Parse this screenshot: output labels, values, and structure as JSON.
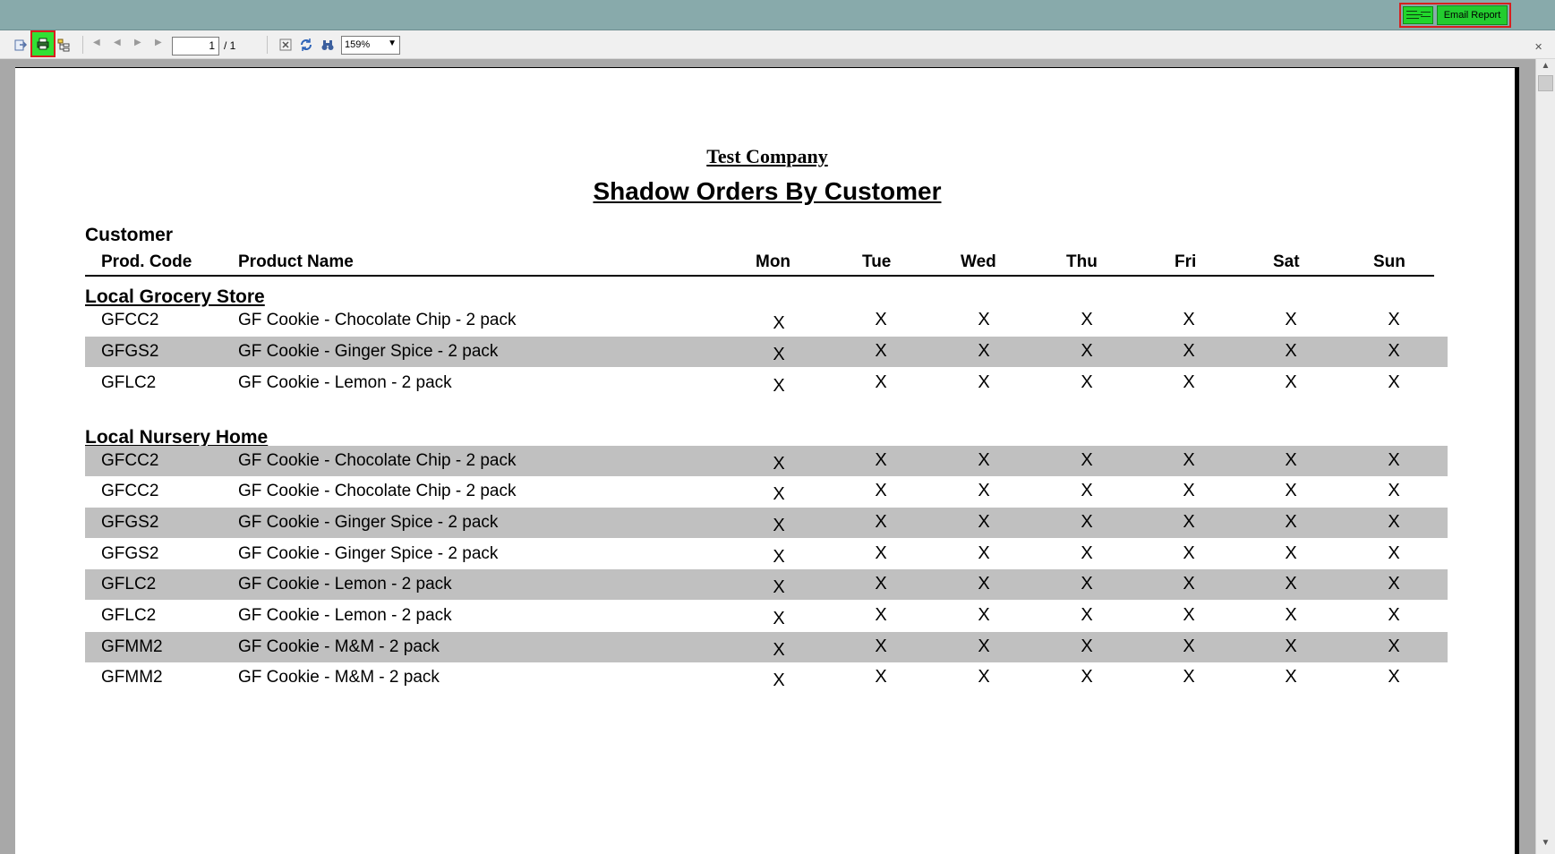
{
  "toolbar": {
    "email_label": "Email Report",
    "page_current": "1",
    "page_total": "/ 1",
    "zoom": "159%"
  },
  "report": {
    "company": "Test Company",
    "title": "Shadow Orders By Customer",
    "customer_header": "Customer",
    "columns": {
      "code": "Prod. Code",
      "name": "Product Name",
      "mon": "Mon",
      "tue": "Tue",
      "wed": "Wed",
      "thu": "Thu",
      "fri": "Fri",
      "sat": "Sat",
      "sun": "Sun"
    },
    "groups": [
      {
        "name": "Local Grocery Store",
        "rows": [
          {
            "code": "GFCC2",
            "name": "GF Cookie - Chocolate Chip - 2 pack",
            "mon": "X",
            "tue": "X",
            "wed": "X",
            "thu": "X",
            "fri": "X",
            "sat": "X",
            "sun": "X"
          },
          {
            "code": "GFGS2",
            "name": "GF Cookie - Ginger Spice - 2 pack",
            "mon": "X",
            "tue": "X",
            "wed": "X",
            "thu": "X",
            "fri": "X",
            "sat": "X",
            "sun": "X"
          },
          {
            "code": "GFLC2",
            "name": "GF Cookie - Lemon - 2 pack",
            "mon": "X",
            "tue": "X",
            "wed": "X",
            "thu": "X",
            "fri": "X",
            "sat": "X",
            "sun": "X"
          }
        ]
      },
      {
        "name": "Local Nursery Home",
        "rows": [
          {
            "code": "GFCC2",
            "name": "GF Cookie - Chocolate Chip - 2 pack",
            "mon": "X",
            "tue": "X",
            "wed": "X",
            "thu": "X",
            "fri": "X",
            "sat": "X",
            "sun": "X"
          },
          {
            "code": "GFCC2",
            "name": "GF Cookie - Chocolate Chip - 2 pack",
            "mon": "X",
            "tue": "X",
            "wed": "X",
            "thu": "X",
            "fri": "X",
            "sat": "X",
            "sun": "X"
          },
          {
            "code": "GFGS2",
            "name": "GF Cookie - Ginger Spice - 2 pack",
            "mon": "X",
            "tue": "X",
            "wed": "X",
            "thu": "X",
            "fri": "X",
            "sat": "X",
            "sun": "X"
          },
          {
            "code": "GFGS2",
            "name": "GF Cookie - Ginger Spice - 2 pack",
            "mon": "X",
            "tue": "X",
            "wed": "X",
            "thu": "X",
            "fri": "X",
            "sat": "X",
            "sun": "X"
          },
          {
            "code": "GFLC2",
            "name": "GF Cookie - Lemon - 2 pack",
            "mon": "X",
            "tue": "X",
            "wed": "X",
            "thu": "X",
            "fri": "X",
            "sat": "X",
            "sun": "X"
          },
          {
            "code": "GFLC2",
            "name": "GF Cookie - Lemon - 2 pack",
            "mon": "X",
            "tue": "X",
            "wed": "X",
            "thu": "X",
            "fri": "X",
            "sat": "X",
            "sun": "X"
          },
          {
            "code": "GFMM2",
            "name": "GF Cookie - M&M - 2 pack",
            "mon": "X",
            "tue": "X",
            "wed": "X",
            "thu": "X",
            "fri": "X",
            "sat": "X",
            "sun": "X"
          },
          {
            "code": "GFMM2",
            "name": "GF Cookie - M&M - 2 pack",
            "mon": "X",
            "tue": "X",
            "wed": "X",
            "thu": "X",
            "fri": "X",
            "sat": "X",
            "sun": "X"
          }
        ]
      }
    ]
  },
  "colors": {
    "title_bar": "#88aaab",
    "highlight_green": "#32e034",
    "highlight_border": "#d81e1e",
    "row_shade": "#c0c0c0"
  },
  "icons": {
    "export": "export-icon",
    "print": "print-icon",
    "group_tree": "group-tree-icon",
    "first": "first-page-icon",
    "prev": "prev-page-icon",
    "next": "next-page-icon",
    "last": "last-page-icon",
    "stop": "stop-icon",
    "refresh": "refresh-icon",
    "search": "binoculars-icon",
    "close": "close-icon",
    "email": "email-icon"
  }
}
